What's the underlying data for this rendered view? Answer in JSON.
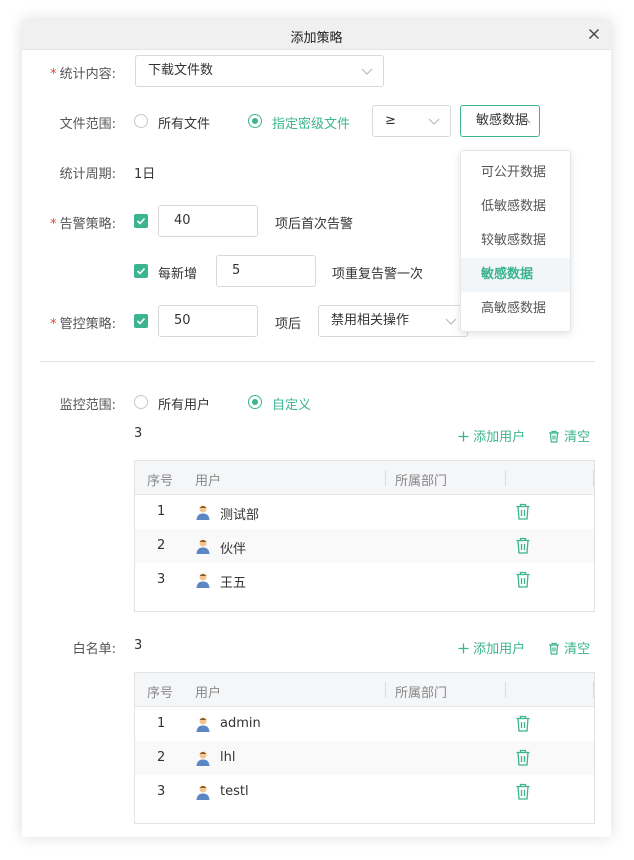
{
  "dialog": {
    "title": "添加策略"
  },
  "stat_content": {
    "label": "统计内容:",
    "value": "下载文件数"
  },
  "file_scope": {
    "label": "文件范围:",
    "option_all": "所有文件",
    "option_level": "指定密级文件",
    "operator": "≥",
    "level_value": "敏感数据"
  },
  "level_dropdown": {
    "options": [
      "可公开数据",
      "低敏感数据",
      "较敏感数据",
      "敏感数据",
      "高敏感数据"
    ],
    "selected": "敏感数据"
  },
  "period": {
    "label": "统计周期:",
    "value": "1日"
  },
  "alert": {
    "label": "告警策略:",
    "first_value": "40",
    "first_suffix": "项后首次告警",
    "repeat_label": "每新增",
    "repeat_value": "5",
    "repeat_suffix": "项重复告警一次"
  },
  "control": {
    "label": "管控策略:",
    "value": "50",
    "suffix": "项后",
    "action": "禁用相关操作"
  },
  "monitor": {
    "label": "监控范围:",
    "option_all": "所有用户",
    "option_custom": "自定义",
    "count": "3",
    "add_label": "添加用户",
    "clear_label": "清空",
    "columns": [
      "序号",
      "用户",
      "所属部门"
    ],
    "rows": [
      {
        "no": "1",
        "user": "测试部",
        "dept": ""
      },
      {
        "no": "2",
        "user": "伙伴",
        "dept": ""
      },
      {
        "no": "3",
        "user": "王五",
        "dept": ""
      }
    ]
  },
  "whitelist": {
    "label": "白名单:",
    "count": "3",
    "add_label": "添加用户",
    "clear_label": "清空",
    "columns": [
      "序号",
      "用户",
      "所属部门"
    ],
    "rows": [
      {
        "no": "1",
        "user": "admin",
        "dept": ""
      },
      {
        "no": "2",
        "user": "lhl",
        "dept": ""
      },
      {
        "no": "3",
        "user": "testl",
        "dept": ""
      }
    ]
  },
  "colors": {
    "accent": "#3bb48f",
    "required": "#e2463c"
  }
}
